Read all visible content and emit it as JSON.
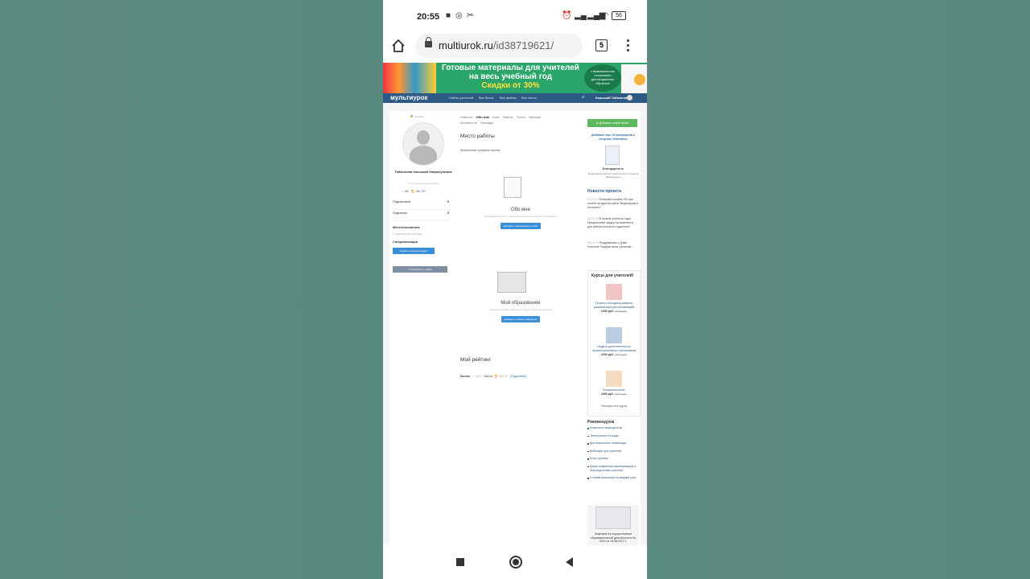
{
  "status": {
    "time": "20:55",
    "battery": "56"
  },
  "browser": {
    "url_host": "multiurok.ru",
    "url_path": "/id38719621/",
    "tab_count": "5"
  },
  "banner": {
    "line1": "Готовые материалы для учителей",
    "line2": "на весь учебный год",
    "discount": "Скидки от 30%",
    "badge": "с возможностью оплачивать дистанционное обучение"
  },
  "sitenav": {
    "logo": "мультиурок",
    "links": [
      "Сайты учителей",
      "Все блоги",
      "Все файлы",
      "Все тесты"
    ],
    "user": "Канышай Таймонова"
  },
  "profile": {
    "online": "на сайте",
    "name": "Таймонова Канышай Умарахуновна",
    "role": "Учитель начальных классов",
    "points": "150",
    "rank": "136 787",
    "subscribers_label": "Подписчики",
    "subscribers_count": "0",
    "subscriptions_label": "Подписки",
    "subscriptions_count": "0",
    "location_label": "Местоположение",
    "location_value": "Кыргызстан, Баткен",
    "spec_label": "Специализация",
    "spec_button": "Укажите специализацию",
    "share_button": "Рассказать о сайте"
  },
  "main": {
    "tabs": [
      "Новости",
      "Обо мне",
      "Блог",
      "Файлы",
      "Тесты",
      "Галерея",
      "Активность",
      "Награды"
    ],
    "active_tab": "Обо мне",
    "work_heading": "Место работы",
    "work_value": "Манкоская средняя школа",
    "about_title": "Обо мне",
    "about_desc": "Расскажите о себе, о своих интересах, как пришли в профессию",
    "about_button": "Добавить информацию о себе",
    "edu_title": "Мой образование",
    "edu_desc": "Укажите учебные заведения и курсы, оконченные вами",
    "edu_button": "Добавить учебное заведение",
    "rating_heading": "Мой рейтинг",
    "rating_points_label": "Баллы:",
    "rating_points": "150.0",
    "rating_place_label": "Место:",
    "rating_place": "136737",
    "rating_more": "(Подробнее)"
  },
  "right": {
    "add_file": "Добавить новый файл",
    "promo": "Добавьте ещё 15 материалов и получите бесплатно",
    "promo_cert": "Благодарность",
    "promo_cert_desc": "За активное участие в деятельности проекта «Мультиурок»",
    "news_heading": "Новости проекта",
    "news": [
      {
        "date": "11.11.22",
        "text": "Получайте кэшбэк 5% при оплате продуктов сайта \"Видеоуроки в Интернет\"!"
      },
      {
        "date": "06.09.22",
        "text": "В начале учебного года! Праздничные скидки на комплекты для работы в классе и удаленно"
      },
      {
        "date": "05.10.22",
        "text": "Поздравляем с Днём Учителя! Подарки всем учителям..."
      }
    ],
    "courses_heading": "Курсы для учителей!",
    "courses": [
      {
        "title": "Теория и методика развития дошкольника для организаций",
        "price": "1200 руб.",
        "old": "4000 руб."
      },
      {
        "title": "Педагог дополнительного профессионального образования",
        "price": "1200 руб.",
        "old": "4000 руб."
      },
      {
        "title": "Конфликтология",
        "price": "1800 руб.",
        "old": "6000 руб."
      }
    ],
    "courses_all": "Смотреть все курсы",
    "rec_heading": "Рекомендуем",
    "rec": [
      "Комплекты видеоуроков",
      "Электронные тетради",
      "Дистанционные олимпиады",
      "Вебинары для учителей",
      "Блоц-турниры",
      "Курсы повышения квалификации и переподготовки учителей",
      "Готовый практикум на каждый урок"
    ],
    "license": "Лицензия на осуществление образовательной деятельности № 5201 от 24.08.2017 г."
  }
}
